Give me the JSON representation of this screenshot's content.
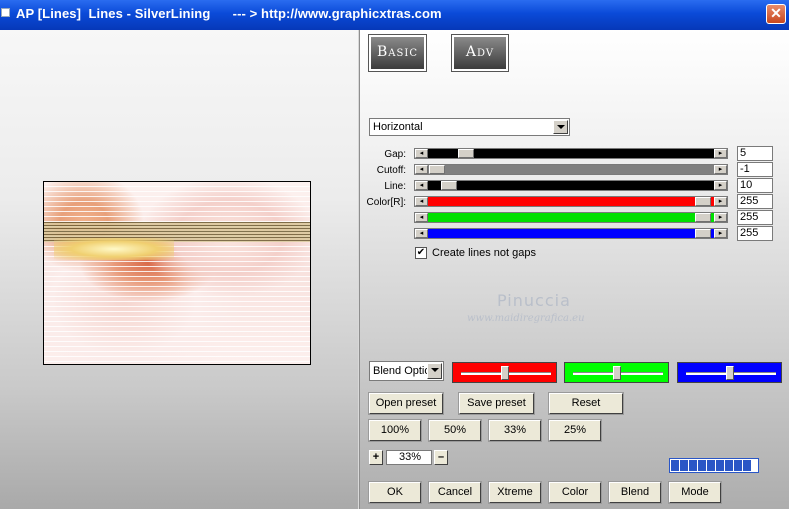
{
  "window": {
    "title": "AP [Lines]  Lines - SilverLining      --- > http://www.graphicxtras.com",
    "close_glyph": "✕"
  },
  "tabs": {
    "basic": "Basic",
    "adv": "Adv"
  },
  "mode_select": {
    "value": "Horizontal"
  },
  "sliders": [
    {
      "label": "Gap:",
      "value": "5",
      "track_color": "#000000"
    },
    {
      "label": "Cutoff:",
      "value": "-1",
      "track_color": "#808080"
    },
    {
      "label": "Line:",
      "value": "10",
      "track_color": "#000000"
    },
    {
      "label": "Color[R]:",
      "value": "255",
      "track_color": "#ff0000"
    },
    {
      "label": "",
      "value": "255",
      "track_color": "#00e000"
    },
    {
      "label": "",
      "value": "255",
      "track_color": "#0000ff"
    }
  ],
  "checkbox": {
    "label": "Create lines not gaps",
    "checked": true,
    "mark": "✔"
  },
  "watermark": {
    "name": "Pinuccia",
    "site": "www.maidiregrafica.eu"
  },
  "blend_select": {
    "value": "Blend Optio"
  },
  "color_boxes": [
    "#ff0000",
    "#00ff00",
    "#0000ff"
  ],
  "buttons": {
    "open_preset": "Open preset",
    "save_preset": "Save preset",
    "reset": "Reset",
    "zoom_100": "100%",
    "zoom_50": "50%",
    "zoom_33": "33%",
    "zoom_25": "25%",
    "ok": "OK",
    "cancel": "Cancel",
    "xtreme": "Xtreme",
    "color": "Color",
    "blend": "Blend",
    "mode": "Mode"
  },
  "zoom": {
    "plus": "+",
    "minus": "–",
    "value": "33%"
  },
  "progress": {
    "segments_filled": 9,
    "segments_total": 9
  }
}
